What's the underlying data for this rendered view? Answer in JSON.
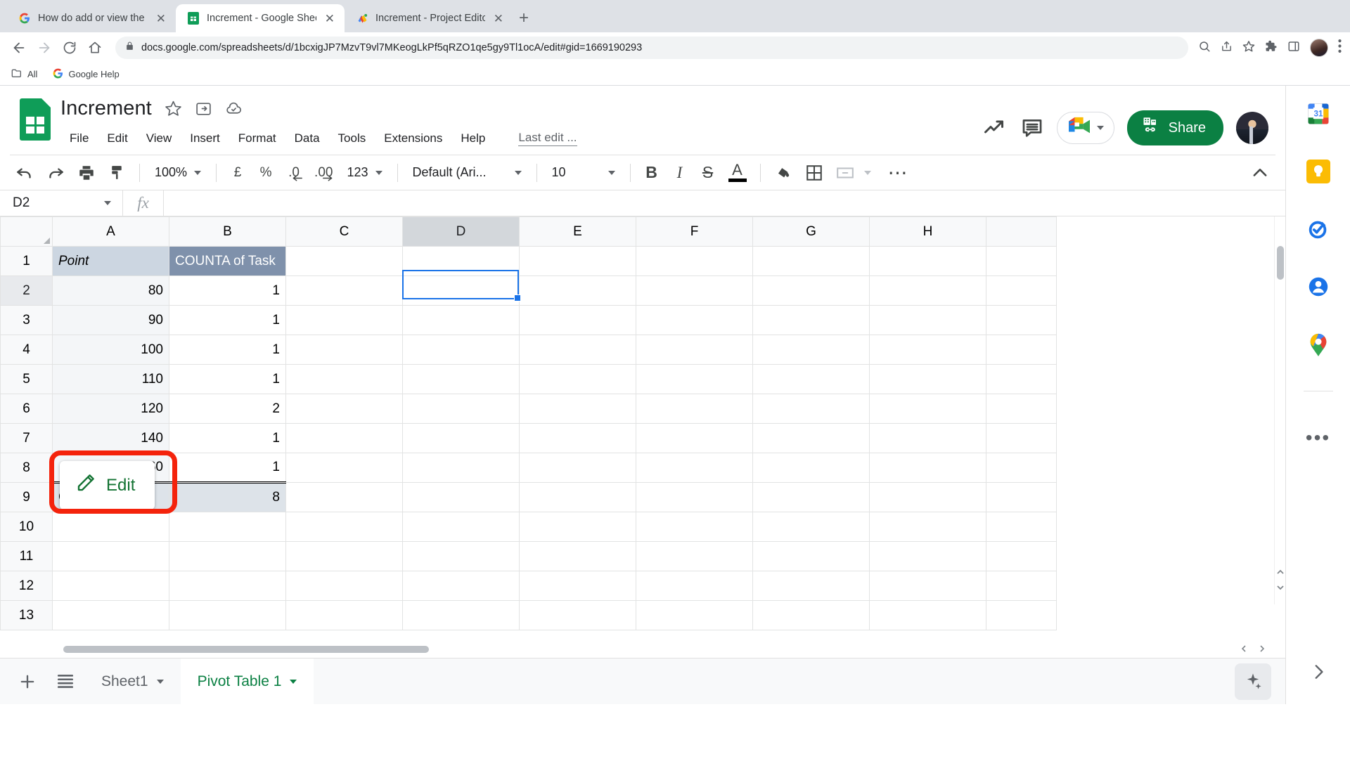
{
  "browser": {
    "tabs": [
      {
        "title": "How do add or view the edit bu",
        "favicon": "google-icon",
        "active": false
      },
      {
        "title": "Increment - Google Sheets",
        "favicon": "sheets-icon",
        "active": true
      },
      {
        "title": "Increment - Project Editor - Ap",
        "favicon": "appsscript-icon",
        "active": false
      }
    ],
    "new_tab_label": "+",
    "url": "docs.google.com/spreadsheets/d/1bcxigJP7MzvT9vl7MKeogLkPf5qRZO1qe5gy9Tl1ocA/edit#gid=1669190293",
    "bookmarks": [
      {
        "label": "All",
        "icon": "folder-icon"
      },
      {
        "label": "Google Help",
        "icon": "google-icon"
      }
    ]
  },
  "sheets": {
    "doc_title": "Increment",
    "menus": [
      "File",
      "Edit",
      "View",
      "Insert",
      "Format",
      "Data",
      "Tools",
      "Extensions",
      "Help"
    ],
    "last_edit": "Last edit ...",
    "share_label": "Share",
    "toolbar": {
      "zoom": "100%",
      "currency": "£",
      "percent": "%",
      "decimal_decrease": ".0",
      "decimal_increase": ".00",
      "number_format": "123",
      "font": "Default (Ari...",
      "font_size": "10",
      "bold": "B",
      "italic": "I",
      "strikethrough": "S",
      "text_color": "A",
      "more": "⋯"
    },
    "formula_bar": {
      "name_box": "D2",
      "fx_label": "fx",
      "formula_value": ""
    },
    "grid": {
      "columns": [
        "A",
        "B",
        "C",
        "D",
        "E",
        "F",
        "G",
        "H"
      ],
      "selected_column": "D",
      "selected_row": "2",
      "rows": [
        {
          "n": "1",
          "a": "Point",
          "b": "COUNTA of Task"
        },
        {
          "n": "2",
          "a": "80",
          "b": "1"
        },
        {
          "n": "3",
          "a": "90",
          "b": "1"
        },
        {
          "n": "4",
          "a": "100",
          "b": "1"
        },
        {
          "n": "5",
          "a": "110",
          "b": "1"
        },
        {
          "n": "6",
          "a": "120",
          "b": "2"
        },
        {
          "n": "7",
          "a": "140",
          "b": "1"
        },
        {
          "n": "8",
          "a": "160",
          "b": "1"
        },
        {
          "n": "9",
          "a": "Grand Total",
          "b": "8"
        },
        {
          "n": "10",
          "a": "",
          "b": ""
        },
        {
          "n": "11",
          "a": "",
          "b": ""
        },
        {
          "n": "12",
          "a": "",
          "b": ""
        },
        {
          "n": "13",
          "a": "",
          "b": ""
        }
      ]
    },
    "edit_button": {
      "label": "Edit",
      "icon": "pencil-icon",
      "highlight_color": "#f4230c"
    },
    "sheet_tabs": [
      {
        "label": "Sheet1",
        "active": false
      },
      {
        "label": "Pivot Table 1",
        "active": true
      }
    ]
  },
  "side_rail": {
    "items": [
      {
        "name": "calendar",
        "label": "31"
      },
      {
        "name": "keep",
        "label": ""
      },
      {
        "name": "tasks",
        "label": ""
      },
      {
        "name": "contacts",
        "label": ""
      },
      {
        "name": "maps",
        "label": ""
      }
    ],
    "more_label": "•••",
    "expand_label": "›"
  }
}
